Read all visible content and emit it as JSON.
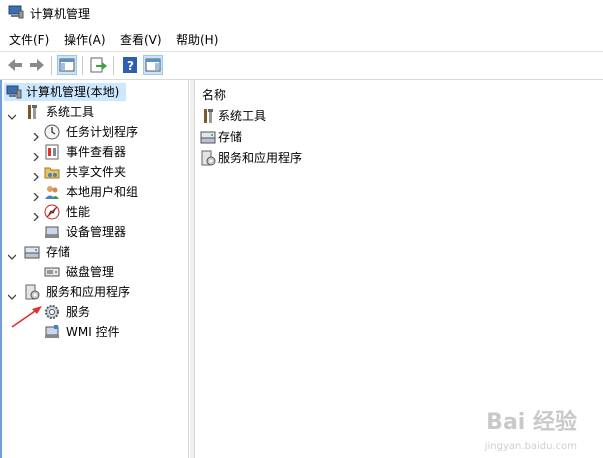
{
  "window": {
    "title": "计算机管理"
  },
  "menu": [
    "文件(F)",
    "操作(A)",
    "查看(V)",
    "帮助(H)"
  ],
  "toolbar": {
    "buttons": [
      "back-icon",
      "forward-icon",
      "show-hide-console-tree-icon",
      "export-list-icon",
      "help-icon",
      "show-hide-action-pane-icon"
    ]
  },
  "tree": {
    "root": "计算机管理(本地)",
    "system_tools": "系统工具",
    "task_scheduler": "任务计划程序",
    "event_viewer": "事件查看器",
    "shared_folders": "共享文件夹",
    "local_users": "本地用户和组",
    "performance": "性能",
    "device_manager": "设备管理器",
    "storage": "存储",
    "disk_management": "磁盘管理",
    "services_apps": "服务和应用程序",
    "services": "服务",
    "wmi": "WMI 控件"
  },
  "list": {
    "column_name": "名称",
    "items": [
      "系统工具",
      "存储",
      "服务和应用程序"
    ]
  },
  "watermark": {
    "text": "Bai 经验",
    "sub": "jingyan.baidu.com"
  },
  "colors": {
    "selection": "#cce8ff",
    "accent": "#6fa0d8",
    "arrow": "#e0302a"
  }
}
